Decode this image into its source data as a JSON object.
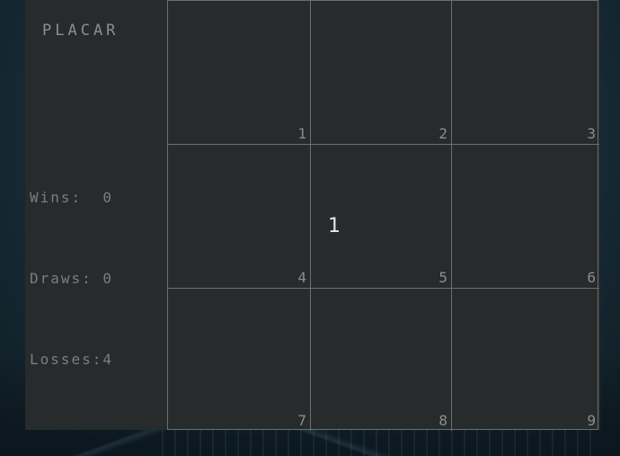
{
  "scoreboard": {
    "title": "PLACAR",
    "wins": "Wins:  0",
    "draws": "Draws: 0",
    "losses": "Losses:4"
  },
  "board": {
    "cells": [
      "1",
      "2",
      "3",
      "4",
      "5",
      "6",
      "7",
      "8",
      "9"
    ]
  },
  "marker": {
    "text": "1"
  }
}
